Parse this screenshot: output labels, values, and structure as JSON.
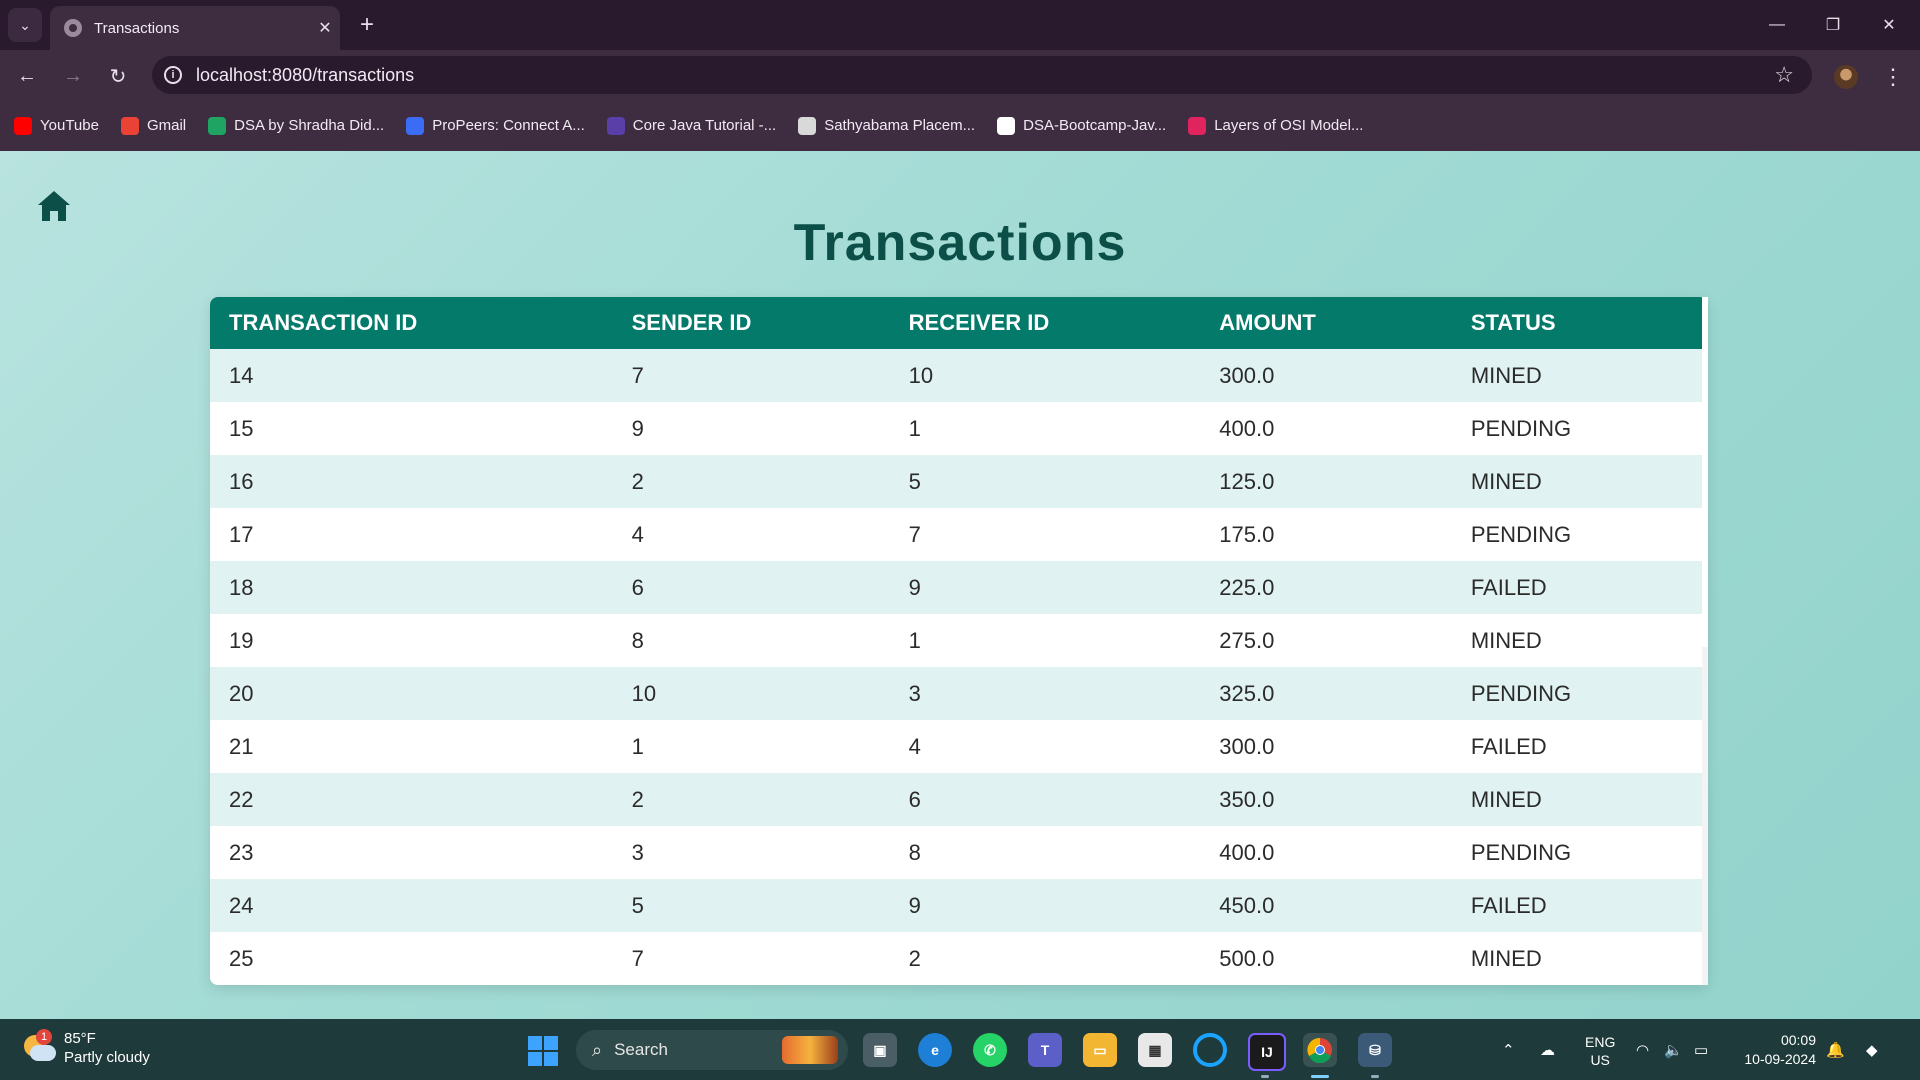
{
  "browser": {
    "tab_title": "Transactions",
    "url": "localhost:8080/transactions",
    "bookmarks": [
      {
        "label": "YouTube",
        "icon": "youtube-icon",
        "color": "#ff0000"
      },
      {
        "label": "Gmail",
        "icon": "gmail-icon",
        "color": "#ea4335"
      },
      {
        "label": "DSA by Shradha Did...",
        "icon": "sheets-icon",
        "color": "#1fa463"
      },
      {
        "label": "ProPeers: Connect A...",
        "icon": "propeers-icon",
        "color": "#3b6cf6"
      },
      {
        "label": "Core Java Tutorial -...",
        "icon": "st-icon",
        "color": "#5b3fa8"
      },
      {
        "label": "Sathyabama Placem...",
        "icon": "sathyabama-icon",
        "color": "#d9d9d9"
      },
      {
        "label": "DSA-Bootcamp-Jav...",
        "icon": "github-icon",
        "color": "#ffffff"
      },
      {
        "label": "Layers of OSI Model...",
        "icon": "osi-icon",
        "color": "#e0245e"
      }
    ]
  },
  "page": {
    "title": "Transactions",
    "table": {
      "headers": [
        "TRANSACTION ID",
        "SENDER ID",
        "RECEIVER ID",
        "AMOUNT",
        "STATUS"
      ],
      "rows": [
        [
          "14",
          "7",
          "10",
          "300.0",
          "MINED"
        ],
        [
          "15",
          "9",
          "1",
          "400.0",
          "PENDING"
        ],
        [
          "16",
          "2",
          "5",
          "125.0",
          "MINED"
        ],
        [
          "17",
          "4",
          "7",
          "175.0",
          "PENDING"
        ],
        [
          "18",
          "6",
          "9",
          "225.0",
          "FAILED"
        ],
        [
          "19",
          "8",
          "1",
          "275.0",
          "MINED"
        ],
        [
          "20",
          "10",
          "3",
          "325.0",
          "PENDING"
        ],
        [
          "21",
          "1",
          "4",
          "300.0",
          "FAILED"
        ],
        [
          "22",
          "2",
          "6",
          "350.0",
          "MINED"
        ],
        [
          "23",
          "3",
          "8",
          "400.0",
          "PENDING"
        ],
        [
          "24",
          "5",
          "9",
          "450.0",
          "FAILED"
        ],
        [
          "25",
          "7",
          "2",
          "500.0",
          "MINED"
        ]
      ]
    },
    "colors": {
      "header_bg": "#047a6b",
      "title": "#0b4f48",
      "row_alt": "#e0f2f1"
    }
  },
  "taskbar": {
    "weather_temp": "85°F",
    "weather_desc": "Partly cloudy",
    "weather_badge": "1",
    "search_placeholder": "Search",
    "language": "ENG",
    "region": "US",
    "time": "00:09",
    "date": "10-09-2024"
  }
}
